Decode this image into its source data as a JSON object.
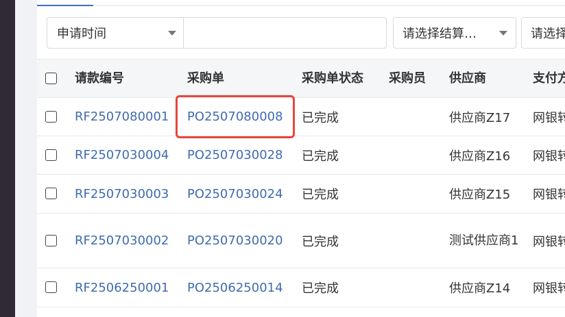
{
  "filters": {
    "date_type_label": "申请时间",
    "settlement_placeholder": "请选择结算…",
    "third_placeholder": "请选择"
  },
  "table": {
    "columns": [
      "请款编号",
      "采购单",
      "采购单状态",
      "采购员",
      "供应商",
      "支付方式"
    ],
    "rows": [
      {
        "request_no": "RF2507080001",
        "po_no": "PO2507080008",
        "po_status": "已完成",
        "buyer": "",
        "supplier": "供应商Z17",
        "pay": "网银转账"
      },
      {
        "request_no": "RF2507030004",
        "po_no": "PO2507030028",
        "po_status": "已完成",
        "buyer": "",
        "supplier": "供应商Z16",
        "pay": "网银转账"
      },
      {
        "request_no": "RF2507030003",
        "po_no": "PO2507030024",
        "po_status": "已完成",
        "buyer": "",
        "supplier": "供应商Z15",
        "pay": "网银转账"
      },
      {
        "request_no": "RF2507030002",
        "po_no": "PO2507030020",
        "po_status": "已完成",
        "buyer": "",
        "supplier": "测试供应商1",
        "pay": "网银转账"
      },
      {
        "request_no": "RF2506250001",
        "po_no": "PO2506250014",
        "po_status": "已完成",
        "buyer": "",
        "supplier": "供应商Z14",
        "pay": "网银转账"
      }
    ]
  },
  "colors": {
    "link": "#3f6bb0",
    "highlight": "#e8453c",
    "sidebar": "#2f2a33"
  }
}
